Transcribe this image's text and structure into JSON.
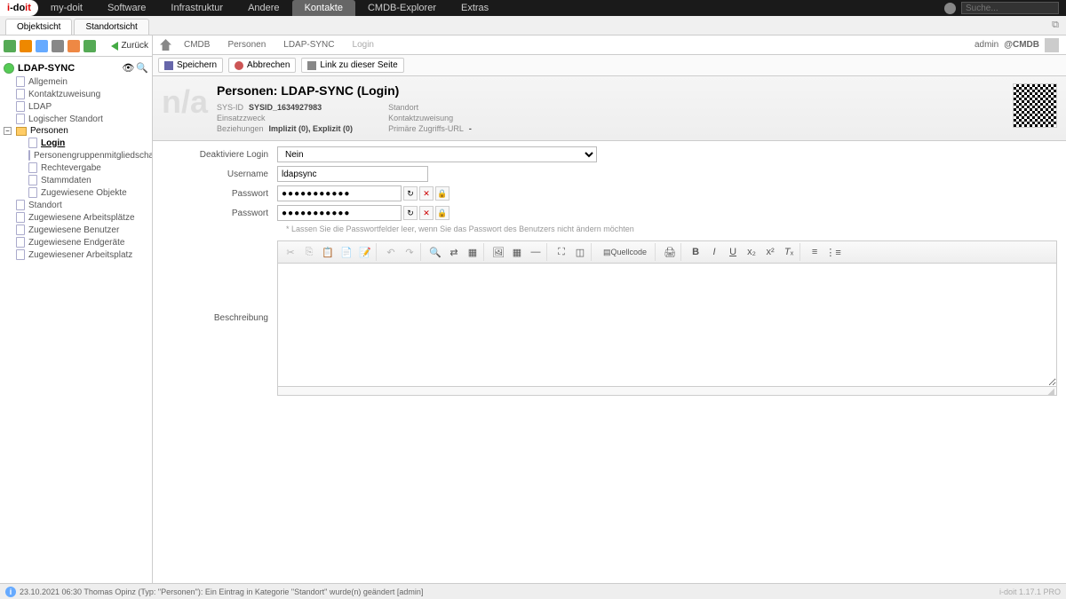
{
  "topnav": {
    "logo": "i-doit",
    "items": [
      "my-doit",
      "Software",
      "Infrastruktur",
      "Andere",
      "Kontakte",
      "CMDB-Explorer",
      "Extras"
    ],
    "active": "Kontakte",
    "search_placeholder": "Suche..."
  },
  "subtabs": {
    "items": [
      "Objektsicht",
      "Standortsicht"
    ],
    "active": "Objektsicht"
  },
  "sidebar": {
    "back": "Zurück",
    "root": "LDAP-SYNC",
    "items1": [
      "Allgemein",
      "Kontaktzuweisung",
      "LDAP",
      "Logischer Standort"
    ],
    "folder": "Personen",
    "items2": [
      "Login",
      "Personengruppenmitgliedschaft",
      "Rechtevergabe",
      "Stammdaten",
      "Zugewiesene Objekte"
    ],
    "bold2": "Login",
    "items3": [
      "Standort",
      "Zugewiesene Arbeitsplätze",
      "Zugewiesene Benutzer",
      "Zugewiesene Endgeräte",
      "Zugewiesener Arbeitsplatz"
    ]
  },
  "crumbs": {
    "items": [
      "CMDB",
      "Personen",
      "LDAP-SYNC"
    ],
    "current": "Login",
    "user": "admin",
    "at": "@CMDB"
  },
  "actions": {
    "save": "Speichern",
    "cancel": "Abbrechen",
    "link": "Link zu dieser Seite"
  },
  "head": {
    "na": "n/a",
    "title": "Personen: LDAP-SYNC (Login)",
    "meta": {
      "sysid_label": "SYS-ID",
      "sysid_val": "SYSID_1634927983",
      "einsatz_label": "Einsatzzweck",
      "bez_label": "Beziehungen",
      "bez_val": "Implizit (0), Explizit (0)",
      "standort_label": "Standort",
      "kontakt_label": "Kontaktzuweisung",
      "url_label": "Primäre Zugriffs-URL",
      "url_val": "-"
    }
  },
  "form": {
    "deactivate_label": "Deaktiviere Login",
    "deactivate_val": "Nein",
    "username_label": "Username",
    "username_val": "ldapsync",
    "pw1_label": "Passwort",
    "pw1_val": "●●●●●●●●●●●",
    "pw2_label": "Passwort",
    "pw2_val": "●●●●●●●●●●●",
    "hint": "* Lassen Sie die Passwortfelder leer, wenn Sie das Passwort des Benutzers nicht ändern möchten",
    "desc_label": "Beschreibung",
    "source_btn": "Quellcode"
  },
  "footer": {
    "msg": "23.10.2021 06:30 Thomas Opinz (Typ: \"Personen\"): Ein Eintrag in Kategorie \"Standort\" wurde(n) geändert [admin]",
    "version": "i-doit 1.17.1 PRO"
  }
}
